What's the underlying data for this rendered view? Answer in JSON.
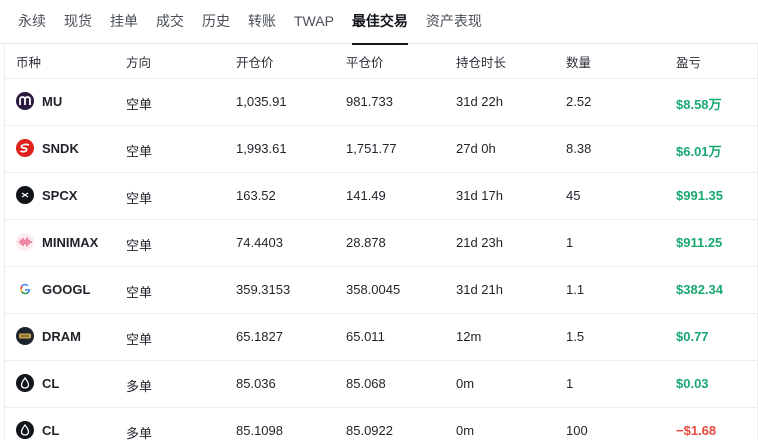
{
  "tabs": [
    {
      "label": "永续",
      "active": false
    },
    {
      "label": "现货",
      "active": false
    },
    {
      "label": "挂单",
      "active": false
    },
    {
      "label": "成交",
      "active": false
    },
    {
      "label": "历史",
      "active": false
    },
    {
      "label": "转账",
      "active": false
    },
    {
      "label": "TWAP",
      "active": false
    },
    {
      "label": "最佳交易",
      "active": true
    },
    {
      "label": "资产表现",
      "active": false
    }
  ],
  "table": {
    "headers": {
      "symbol": "币种",
      "side": "方向",
      "open_price": "开仓价",
      "close_price": "平仓价",
      "duration": "持仓时长",
      "quantity": "数量",
      "pnl": "盈亏"
    },
    "rows": [
      {
        "symbol": "MU",
        "icon": "micron-logo-icon",
        "side": "空单",
        "open_price": "1,035.91",
        "close_price": "981.733",
        "duration": "31d 22h",
        "quantity": "2.52",
        "pnl": "$8.58万",
        "pnl_sign": "positive"
      },
      {
        "symbol": "SNDK",
        "icon": "sandisk-logo-icon",
        "side": "空单",
        "open_price": "1,993.61",
        "close_price": "1,751.77",
        "duration": "27d 0h",
        "quantity": "8.38",
        "pnl": "$6.01万",
        "pnl_sign": "positive"
      },
      {
        "symbol": "SPCX",
        "icon": "spacex-logo-icon",
        "side": "空单",
        "open_price": "163.52",
        "close_price": "141.49",
        "duration": "31d 17h",
        "quantity": "45",
        "pnl": "$991.35",
        "pnl_sign": "positive"
      },
      {
        "symbol": "MINIMAX",
        "icon": "minimax-logo-icon",
        "side": "空单",
        "open_price": "74.4403",
        "close_price": "28.878",
        "duration": "21d 23h",
        "quantity": "1",
        "pnl": "$911.25",
        "pnl_sign": "positive"
      },
      {
        "symbol": "GOOGL",
        "icon": "google-logo-icon",
        "side": "空单",
        "open_price": "359.3153",
        "close_price": "358.0045",
        "duration": "31d 21h",
        "quantity": "1.1",
        "pnl": "$382.34",
        "pnl_sign": "positive"
      },
      {
        "symbol": "DRAM",
        "icon": "dram-logo-icon",
        "side": "空单",
        "open_price": "65.1827",
        "close_price": "65.011",
        "duration": "12m",
        "quantity": "1.5",
        "pnl": "$0.77",
        "pnl_sign": "positive"
      },
      {
        "symbol": "CL",
        "icon": "oil-drop-icon",
        "side": "多单",
        "open_price": "85.036",
        "close_price": "85.068",
        "duration": "0m",
        "quantity": "1",
        "pnl": "$0.03",
        "pnl_sign": "positive"
      },
      {
        "symbol": "CL",
        "icon": "oil-drop-icon",
        "side": "多单",
        "open_price": "85.1098",
        "close_price": "85.0922",
        "duration": "0m",
        "quantity": "100",
        "pnl": "−$1.68",
        "pnl_sign": "negative"
      }
    ]
  },
  "colors": {
    "positive": "#1aa871",
    "negative": "#e8473d",
    "active_tab": "#111418"
  }
}
